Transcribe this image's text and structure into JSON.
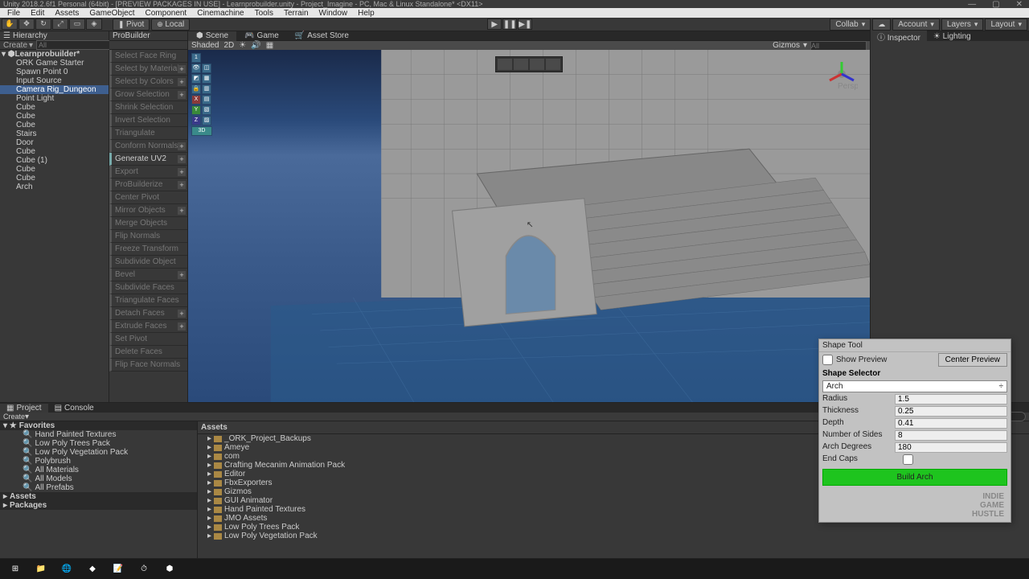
{
  "window": {
    "title": "Unity 2018.2.6f1 Personal (64bit) - [PREVIEW PACKAGES IN USE] - Learnprobuilder.unity - Project_Imagine - PC, Mac & Linux Standalone* <DX11>",
    "minimize": "—",
    "maximize": "▢",
    "close": "✕"
  },
  "menu": [
    "File",
    "Edit",
    "Assets",
    "GameObject",
    "Component",
    "Cinemachine",
    "Tools",
    "Terrain",
    "Window",
    "Help"
  ],
  "toolbar": {
    "pivot": "Pivot",
    "local": "Local",
    "collab": "Collab",
    "account": "Account",
    "layers": "Layers",
    "layout": "Layout"
  },
  "hierarchy": {
    "tab": "Hierarchy",
    "create": "Create",
    "search_placeholder": "All",
    "root": "Learnprobuilder*",
    "items": [
      "ORK Game Starter",
      "Spawn Point 0",
      "Input Source",
      "Camera Rig_Dungeon",
      "Point Light",
      "Cube",
      "Cube",
      "Cube",
      "Stairs",
      "Door",
      "Cube",
      "Cube (1)",
      "Cube",
      "Cube",
      "Arch"
    ],
    "selected_index": 3
  },
  "probuilder": {
    "tab": "ProBuilder",
    "items": [
      {
        "label": "Select Face Ring",
        "plus": false
      },
      {
        "label": "Select by Material",
        "plus": true
      },
      {
        "label": "Select by Colors",
        "plus": true
      },
      {
        "label": "Grow Selection",
        "plus": true
      },
      {
        "label": "Shrink Selection",
        "plus": false
      },
      {
        "label": "Invert Selection",
        "plus": false
      },
      {
        "label": "Triangulate",
        "plus": false
      },
      {
        "label": "Conform Normals",
        "plus": true
      },
      {
        "label": "Generate UV2",
        "plus": true,
        "active": true
      },
      {
        "label": "Export",
        "plus": true
      },
      {
        "label": "ProBuilderize",
        "plus": true
      },
      {
        "label": "Center Pivot",
        "plus": false
      },
      {
        "label": "Mirror Objects",
        "plus": true
      },
      {
        "label": "Merge Objects",
        "plus": false
      },
      {
        "label": "Flip Normals",
        "plus": false
      },
      {
        "label": "Freeze Transform",
        "plus": false
      },
      {
        "label": "Subdivide Object",
        "plus": false
      },
      {
        "label": "Bevel",
        "plus": true
      },
      {
        "label": "Subdivide Faces",
        "plus": false
      },
      {
        "label": "Triangulate Faces",
        "plus": false
      },
      {
        "label": "Detach Faces",
        "plus": true
      },
      {
        "label": "Extrude Faces",
        "plus": true
      },
      {
        "label": "Set Pivot",
        "plus": false
      },
      {
        "label": "Delete Faces",
        "plus": false
      },
      {
        "label": "Flip Face Normals",
        "plus": false
      }
    ]
  },
  "scene": {
    "tabs": [
      {
        "label": "Scene",
        "active": true
      },
      {
        "label": "Game",
        "active": false
      },
      {
        "label": "Asset Store",
        "active": false
      }
    ],
    "shading": "Shaded",
    "mode_2d": "2D",
    "gizmos": "Gizmos",
    "search_placeholder": "All"
  },
  "inspector": {
    "tabs": [
      {
        "label": "Inspector",
        "active": true
      },
      {
        "label": "Lighting",
        "active": false
      }
    ]
  },
  "project": {
    "tabs": [
      {
        "label": "Project",
        "active": true
      },
      {
        "label": "Console",
        "active": false
      }
    ],
    "create": "Create",
    "favorites_header": "Favorites",
    "favorites": [
      "Hand Painted Textures",
      "Low Poly Trees Pack",
      "Low Poly Vegetation Pack",
      "Polybrush",
      "All Materials",
      "All Models",
      "All Prefabs"
    ],
    "assets_header": "Assets",
    "packages_header": "Packages",
    "assets_path": "Assets",
    "assets_list": [
      "_ORK_Project_Backups",
      "Ameye",
      "com",
      "Crafting Mecanim Animation Pack",
      "Editor",
      "FbxExporters",
      "Gizmos",
      "GUI Animator",
      "Hand Painted Textures",
      "JMO Assets",
      "Low Poly Trees Pack",
      "Low Poly Vegetation Pack"
    ]
  },
  "shape_tool": {
    "title": "Shape Tool",
    "show_preview": "Show Preview",
    "center_preview": "Center Preview",
    "selector_label": "Shape Selector",
    "shape": "Arch",
    "fields": [
      {
        "label": "Radius",
        "value": "1.5"
      },
      {
        "label": "Thickness",
        "value": "0.25"
      },
      {
        "label": "Depth",
        "value": "0.41"
      },
      {
        "label": "Number of Sides",
        "value": "8"
      },
      {
        "label": "Arch Degrees",
        "value": "180"
      },
      {
        "label": "End Caps",
        "value": ""
      }
    ],
    "build_button": "Build Arch",
    "logo": [
      "INDIE",
      "GAME",
      "HUSTLE"
    ]
  },
  "status_bar": ""
}
